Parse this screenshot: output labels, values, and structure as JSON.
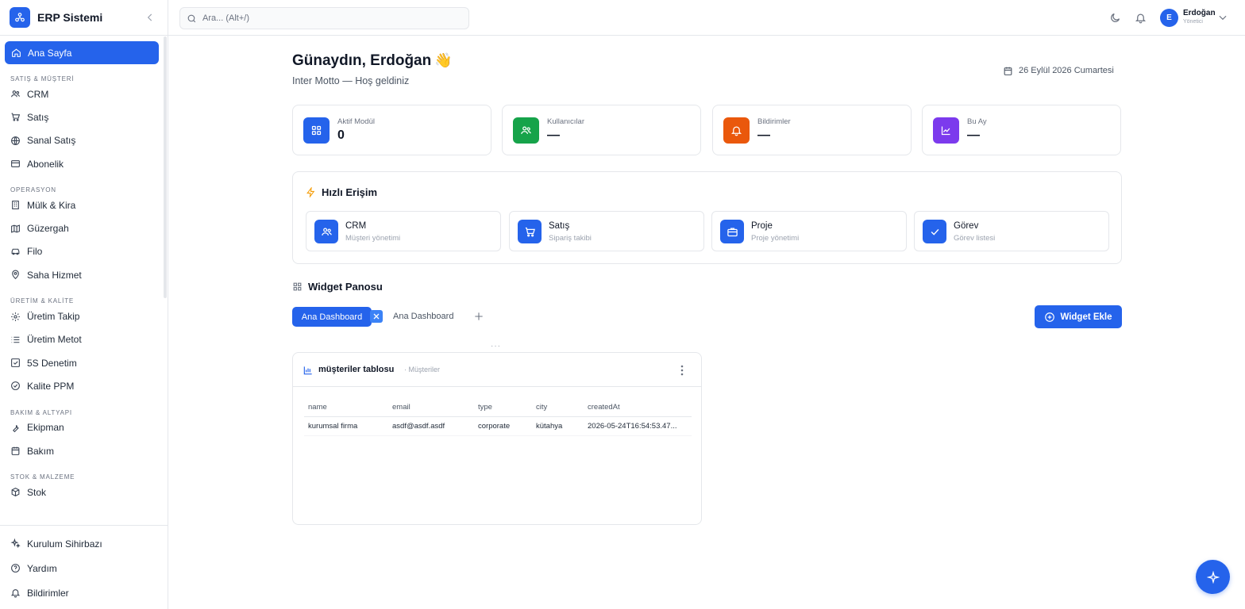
{
  "app": {
    "title": "ERP Sistemi"
  },
  "sidebar": {
    "active": {
      "label": "Ana Sayfa",
      "icon": "home-icon"
    },
    "sections": [
      {
        "title": "SATIŞ & MÜŞTERİ",
        "items": [
          {
            "label": "CRM",
            "icon": "users-icon"
          },
          {
            "label": "Satış",
            "icon": "cart-icon"
          },
          {
            "label": "Sanal Satış",
            "icon": "globe-icon"
          },
          {
            "label": "Abonelik",
            "icon": "card-icon"
          }
        ]
      },
      {
        "title": "OPERASYON",
        "items": [
          {
            "label": "Mülk & Kira",
            "icon": "building-icon"
          },
          {
            "label": "Güzergah",
            "icon": "map-icon"
          },
          {
            "label": "Filo",
            "icon": "car-icon"
          },
          {
            "label": "Saha Hizmet",
            "icon": "pin-icon"
          }
        ]
      },
      {
        "title": "ÜRETİM & KALİTE",
        "items": [
          {
            "label": "Üretim Takip",
            "icon": "gear-icon"
          },
          {
            "label": "Üretim Metot",
            "icon": "list-icon"
          },
          {
            "label": "5S Denetim",
            "icon": "checkbox-icon"
          },
          {
            "label": "Kalite PPM",
            "icon": "check-circle-icon"
          }
        ]
      },
      {
        "title": "BAKIM & ALTYAPI",
        "items": [
          {
            "label": "Ekipman",
            "icon": "wrench-icon"
          },
          {
            "label": "Bakım",
            "icon": "calendar-icon"
          }
        ]
      },
      {
        "title": "STOK & MALZEME",
        "items": [
          {
            "label": "Stok",
            "icon": "box-icon"
          }
        ]
      }
    ],
    "footer": [
      {
        "label": "Kurulum Sihirbazı",
        "icon": "sparkles-icon"
      },
      {
        "label": "Yardım",
        "icon": "help-icon"
      },
      {
        "label": "Bildirimler",
        "icon": "bell-icon"
      }
    ]
  },
  "topbar": {
    "search_placeholder": "Ara... (Alt+/)",
    "user": {
      "initial": "E",
      "name": "Erdoğan",
      "role": "Yönetici"
    }
  },
  "main": {
    "greeting": "Günaydın, Erdoğan",
    "greeting_emoji": "👋",
    "subtitle": "Inter Motto — Hoş geldiniz",
    "date": "26 Eylül 2026 Cumartesi",
    "stats": [
      {
        "label": "Aktif Modül",
        "value": "0",
        "color": "#2563eb",
        "icon": "grid-icon"
      },
      {
        "label": "Kullanıcılar",
        "value": "—",
        "color": "#16a34a",
        "icon": "users-icon"
      },
      {
        "label": "Bildirimler",
        "value": "—",
        "color": "#ea580c",
        "icon": "bell-icon"
      },
      {
        "label": "Bu Ay",
        "value": "—",
        "color": "#7c3aed",
        "icon": "chart-icon"
      }
    ],
    "quick_access": {
      "title": "Hızlı Erişim",
      "items": [
        {
          "name": "CRM",
          "desc": "Müşteri yönetimi",
          "icon": "users-icon"
        },
        {
          "name": "Satış",
          "desc": "Sipariş takibi",
          "icon": "cart-icon"
        },
        {
          "name": "Proje",
          "desc": "Proje yönetimi",
          "icon": "briefcase-icon"
        },
        {
          "name": "Görev",
          "desc": "Görev listesi",
          "icon": "check-icon"
        }
      ]
    },
    "widget_panel": {
      "title": "Widget Panosu",
      "tab_active": "Ana Dashboard",
      "tab_other": "Ana Dashboard",
      "add_label": "Widget Ekle",
      "drag_handle": "···"
    },
    "widget": {
      "title": "müşteriler tablosu",
      "subtitle": "· Müşteriler",
      "columns": [
        "name",
        "email",
        "type",
        "city",
        "createdAt"
      ],
      "rows": [
        [
          "kurumsal firma",
          "asdf@asdf.asdf",
          "corporate",
          "kütahya",
          "2026-05-24T16:54:53.47..."
        ]
      ]
    }
  },
  "colors": {
    "accent": "#2563eb",
    "border": "#e5e7eb"
  }
}
